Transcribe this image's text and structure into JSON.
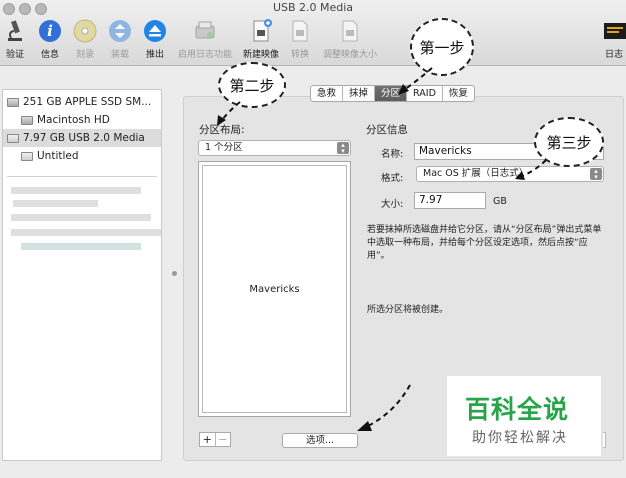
{
  "window": {
    "title": "USB 2.0 Media"
  },
  "toolbar": {
    "items": [
      {
        "label": "验证",
        "icon": "microscope-icon"
      },
      {
        "label": "信息",
        "icon": "info-icon"
      },
      {
        "label": "刻录",
        "icon": "burn-disc-icon"
      },
      {
        "label": "装载",
        "icon": "mount-icon"
      },
      {
        "label": "推出",
        "icon": "eject-icon"
      },
      {
        "label": "启用日志功能",
        "icon": "journal-icon"
      },
      {
        "label": "新建映像",
        "icon": "new-image-icon"
      },
      {
        "label": "转换",
        "icon": "convert-icon"
      },
      {
        "label": "调整映像大小",
        "icon": "resize-image-icon"
      },
      {
        "label": "日志",
        "icon": "log-icon"
      }
    ]
  },
  "sidebar": {
    "items": [
      {
        "label": "251 GB APPLE SSD SM..."
      },
      {
        "label": "Macintosh HD"
      },
      {
        "label": "7.97 GB USB 2.0 Media"
      },
      {
        "label": "Untitled"
      }
    ]
  },
  "tabs": [
    "急救",
    "抹掉",
    "分区",
    "RAID",
    "恢复"
  ],
  "selected_tab": "分区",
  "partition": {
    "layout_label": "分区布局:",
    "layout_value": "1 个分区",
    "partition_name": "Mavericks",
    "info_label": "分区信息",
    "name_label": "名称:",
    "name_value": "Mavericks",
    "format_label": "格式:",
    "format_value": "Mac OS 扩展（日志式）",
    "size_label": "大小:",
    "size_value": "7.97",
    "size_unit": "GB",
    "help_text": "若要抹掉所选磁盘并给它分区，请从“分区布局”弹出式菜单中选取一种布局，并给每个分区设定选项，然后点按“应用”。",
    "status_text": "所选分区将被创建。",
    "add_label": "+",
    "remove_label": "−",
    "options_label": "选项..."
  },
  "annotations": {
    "step1": "第一步",
    "step2": "第二步",
    "step3": "第三步"
  },
  "watermark": {
    "title": "百科全说",
    "subtitle": "助你轻松解决"
  }
}
